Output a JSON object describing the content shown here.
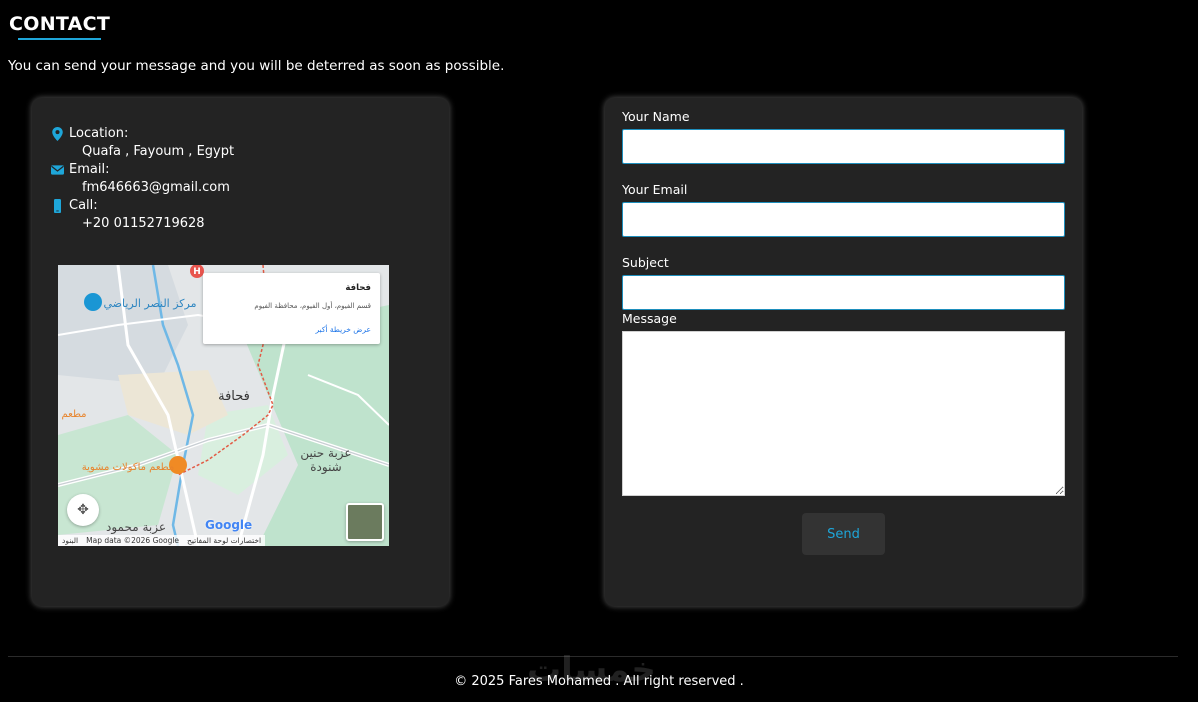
{
  "header": {
    "title": "CONTACT",
    "subtitle": "You can send your message and you will be deterred as soon as possible."
  },
  "contact_info": {
    "location_label": "Location:",
    "location_value": "Quafa , Fayoum , Egypt",
    "email_label": "Email:",
    "email_value": "fm646663@gmail.com",
    "call_label": "Call:",
    "call_value": "+20 01152719628"
  },
  "map": {
    "popup_title": "فحافة",
    "popup_address": "قسم الفيوم، أول الفيوم، محافظة الفيوم",
    "popup_link": "عرض خريطة أكبر",
    "labels": {
      "sports_center": "مركز النصر الرياضي",
      "village": "فحافة",
      "restaurant_left": "مطعم",
      "restaurant": "مطعم ماكولات مشوية",
      "ezbet_hanin": "عزبة حنين",
      "shanuda": "شنودة",
      "ezbet_mahmoud": "عزبة محمود"
    },
    "google_logo": "Google",
    "footer_shortcuts": "البنود",
    "footer_data": "Map data ©2026 Google",
    "footer_keyboard": "اختصارات لوحة المفاتيح",
    "accent_color": "#1ea6d9"
  },
  "form": {
    "name_label": "Your Name",
    "email_label": "Your Email",
    "subject_label": "Subject",
    "message_label": "Message",
    "name_value": "",
    "email_value": "",
    "subject_value": "",
    "message_value": "",
    "send_label": "Send"
  },
  "footer": {
    "copyright": "© 2025 Fares Mohamed . All right reserved .",
    "watermark": "خمسات"
  },
  "icons": {
    "location": "map-pin-icon",
    "email": "envelope-icon",
    "call": "phone-icon"
  },
  "colors": {
    "accent": "#1ea6d9",
    "background": "#000000",
    "card": "#232323"
  }
}
